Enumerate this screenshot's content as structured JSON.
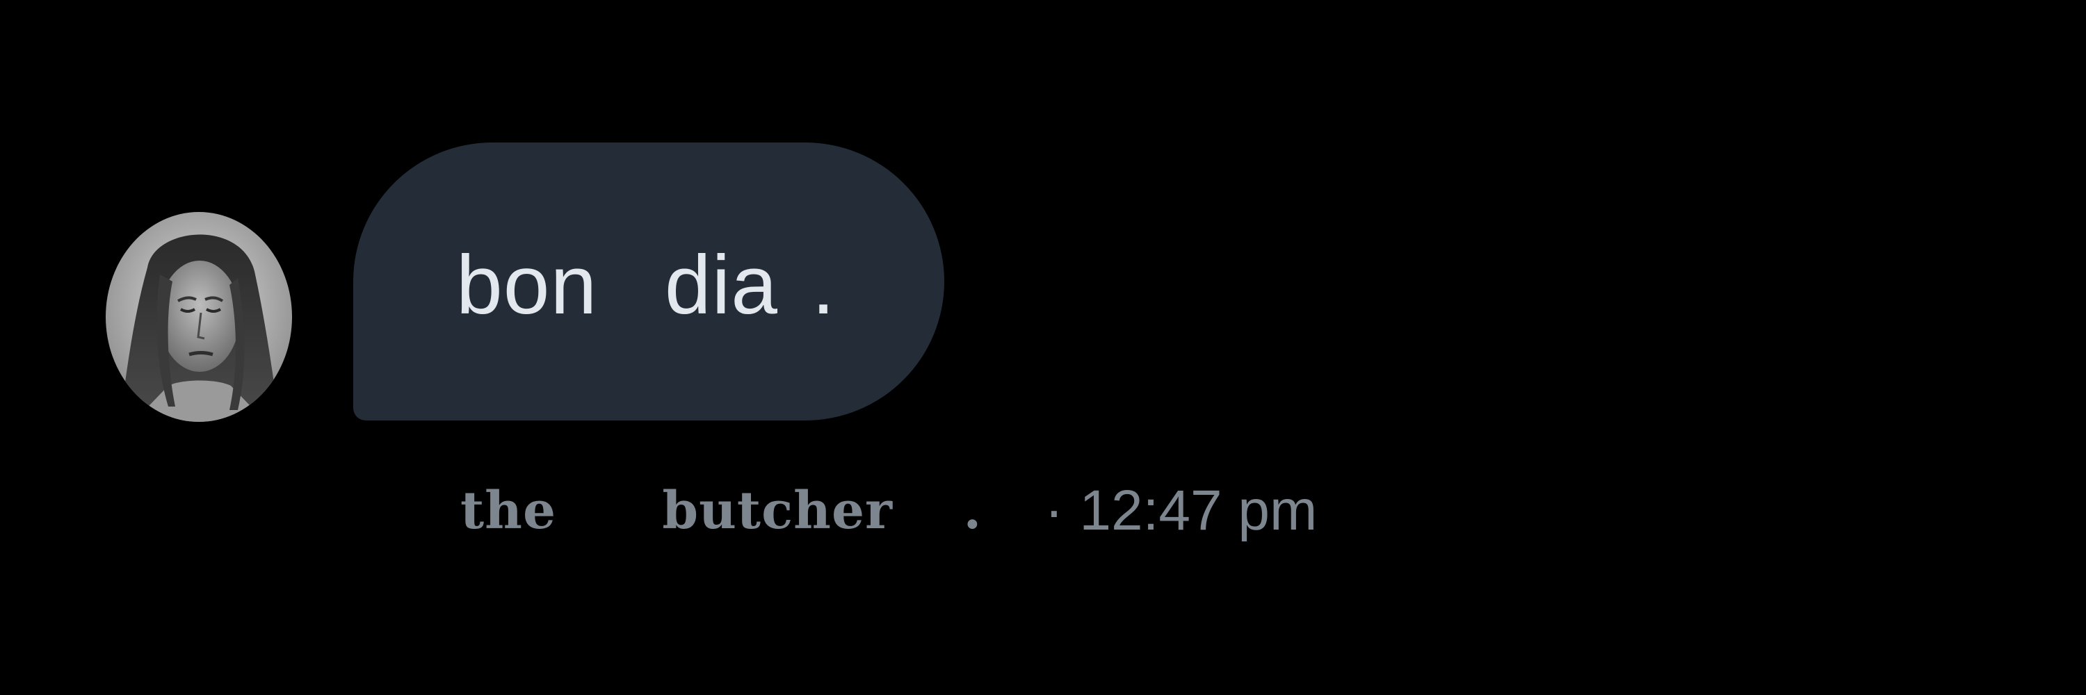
{
  "message": {
    "text": "bon  dia .",
    "sender_name": "the   butcher  .",
    "timestamp": "· 12:47 pm"
  },
  "avatar": {
    "icon": "user-avatar-photo"
  },
  "colors": {
    "background": "#000000",
    "bubble": "#242d37",
    "bubble_text": "#e3e8ee",
    "meta_text": "#7d858e"
  }
}
